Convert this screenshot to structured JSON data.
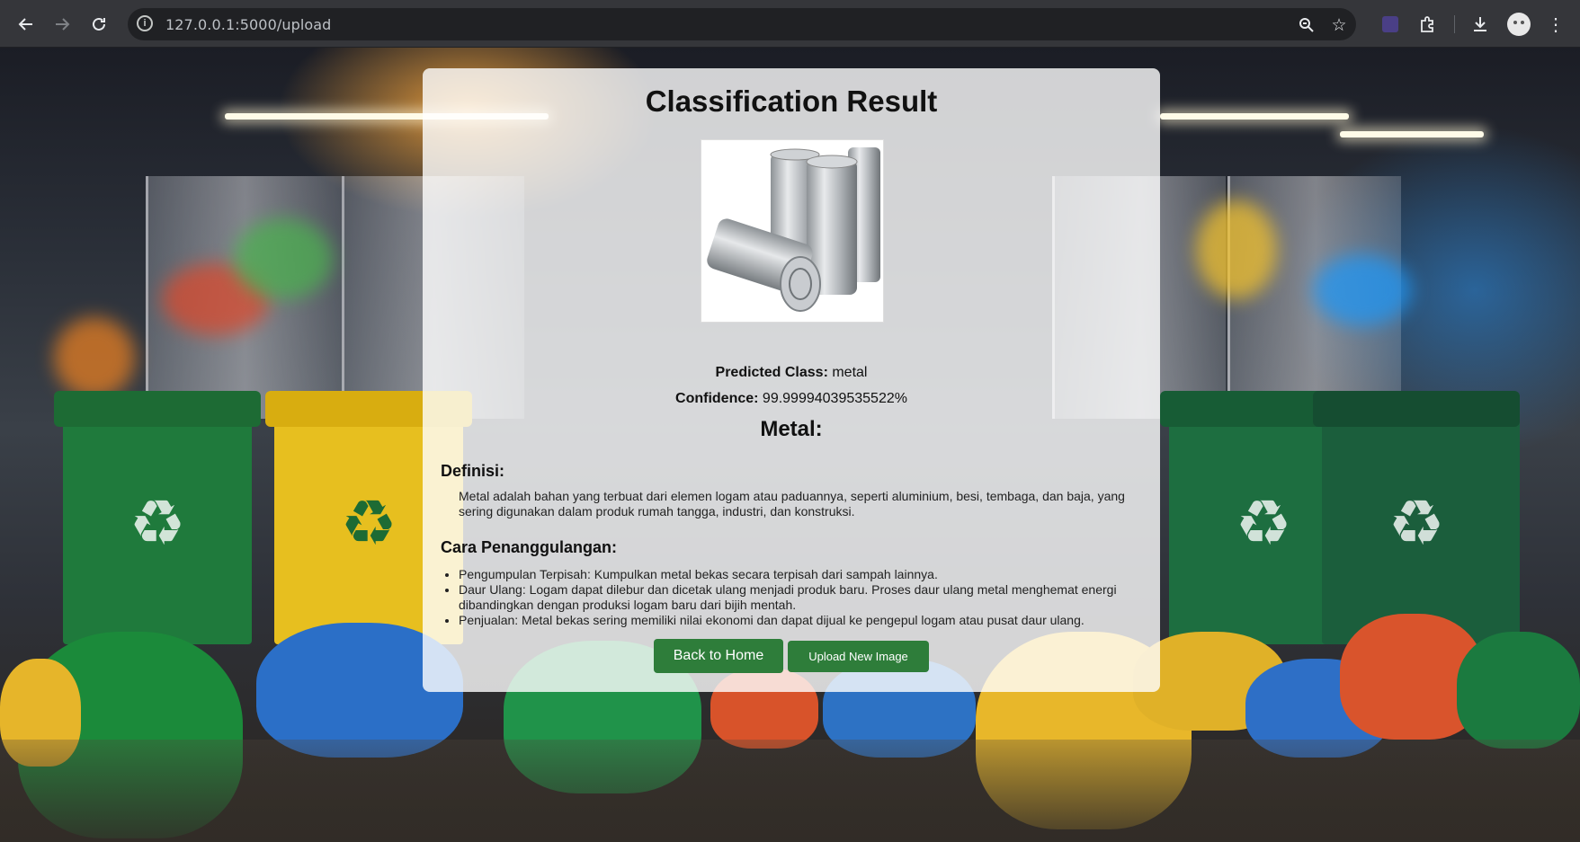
{
  "browser": {
    "url": "127.0.0.1:5000/upload",
    "back_icon": "arrow-left-icon",
    "forward_icon": "arrow-right-icon",
    "reload_icon": "reload-icon"
  },
  "result": {
    "title": "Classification Result",
    "predicted_label": "Predicted Class:",
    "predicted_value": " metal",
    "confidence_label": "Confidence:",
    "confidence_value": " 99.99994039535522%",
    "class_heading": "Metal:"
  },
  "definition": {
    "title": "Definisi:",
    "text": "Metal adalah bahan yang terbuat dari elemen logam atau paduannya, seperti aluminium, besi, tembaga, dan baja, yang sering digunakan dalam produk rumah tangga, industri, dan konstruksi."
  },
  "handling": {
    "title": "Cara Penanggulangan:",
    "items": [
      "Pengumpulan Terpisah: Kumpulkan metal bekas secara terpisah dari sampah lainnya.",
      "Daur Ulang: Logam dapat dilebur dan dicetak ulang menjadi produk baru. Proses daur ulang metal menghemat energi dibandingkan dengan produksi logam baru dari bijih mentah.",
      "Penjualan: Metal bekas sering memiliki nilai ekonomi dan dapat dijual ke pengepul logam atau pusat daur ulang."
    ]
  },
  "buttons": {
    "back_home": "Back to Home",
    "upload_new": "Upload New Image"
  },
  "colors": {
    "button_green": "#2e7d3a",
    "card_bg": "rgba(255,255,255,0.80)"
  }
}
